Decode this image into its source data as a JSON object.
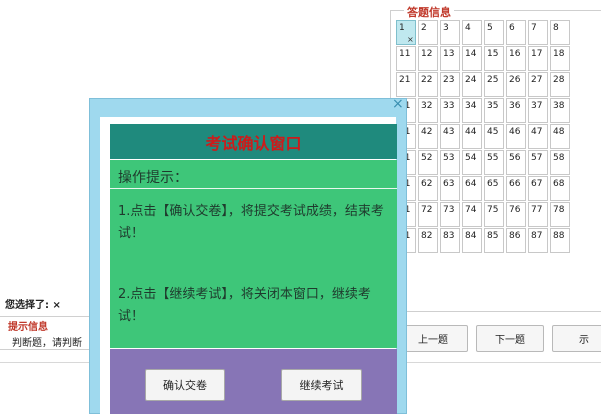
{
  "answer_panel": {
    "title": "答题信息",
    "current_mark": "×",
    "rows": [
      [
        "1",
        "2",
        "3",
        "4",
        "5",
        "6",
        "7",
        "8"
      ],
      [
        "11",
        "12",
        "13",
        "14",
        "15",
        "16",
        "17",
        "18"
      ],
      [
        "21",
        "22",
        "23",
        "24",
        "25",
        "26",
        "27",
        "28"
      ],
      [
        "31",
        "32",
        "33",
        "34",
        "35",
        "36",
        "37",
        "38"
      ],
      [
        "41",
        "42",
        "43",
        "44",
        "45",
        "46",
        "47",
        "48"
      ],
      [
        "51",
        "52",
        "53",
        "54",
        "55",
        "56",
        "57",
        "58"
      ],
      [
        "61",
        "62",
        "63",
        "64",
        "65",
        "66",
        "67",
        "68"
      ],
      [
        "71",
        "72",
        "73",
        "74",
        "75",
        "76",
        "77",
        "78"
      ],
      [
        "81",
        "82",
        "83",
        "84",
        "85",
        "86",
        "87",
        "88"
      ]
    ]
  },
  "selection": {
    "label": "您选择了: ×"
  },
  "tips": {
    "title": "提示信息",
    "text": "判断题，请判断"
  },
  "nav": {
    "prev_label": "上一题",
    "next_label": "下一题",
    "third_label": "示"
  },
  "modal": {
    "close_icon": "×",
    "title": "考试确认窗口",
    "ops_heading": "操作提示：",
    "paragraph1": "1.点击【确认交卷】，将提交考试成绩，结束考试！",
    "paragraph2": "2.点击【继续考试】，将关闭本窗口，继续考试！",
    "confirm_label": "确认交卷",
    "continue_label": "继续考试"
  },
  "colors": {
    "modal_title_bg": "#1f8a7d",
    "modal_title_text": "#cc1b1b",
    "modal_body_bg": "#3ec679",
    "modal_footer_bg": "#8775b6",
    "current_cell_bg": "#bfe8ef",
    "legend_text": "#c0392b"
  }
}
